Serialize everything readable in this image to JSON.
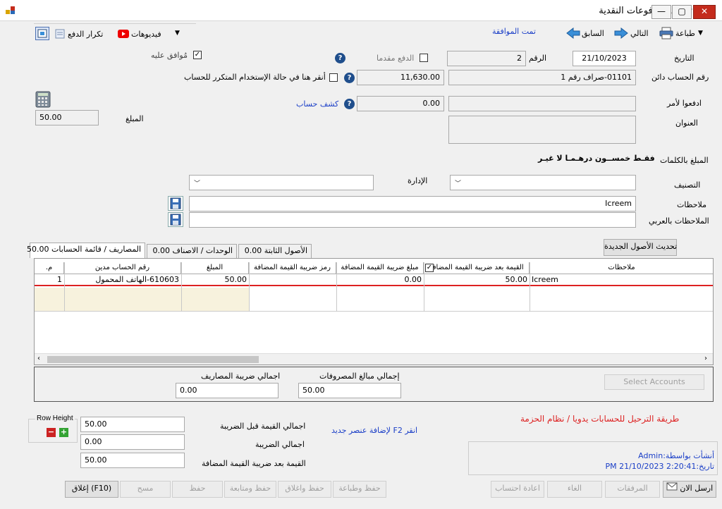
{
  "window": {
    "title": "تعديل المدفوعات النقدية",
    "minimize": "—",
    "maximize": "▢",
    "close": "✕"
  },
  "toolbar": {
    "print": "طباعة",
    "next": "التالي",
    "previous": "السابق",
    "approved": "تمت الموافقة",
    "videos": "فيديوهات",
    "repeat_payment": "تكرار الدفع"
  },
  "form": {
    "date_label": "التاريخ",
    "date_value": "21/10/2023",
    "number_label": "الرقم",
    "number_value": "2",
    "advance_label": "الدفع مقدما",
    "approved_on_label": "مُوافق عليه",
    "credit_account_label": "رقم  الحساب دائن",
    "credit_account_value": "01101-صراف رقم 1",
    "balance_value": "11,630.00",
    "recurring_label": "أنقر هنا في حالة الإستخدام المتكرر للحساب",
    "pay_to_label": "ادفعوا لأمر",
    "pay_to_value": "",
    "statement_value": "0.00",
    "statement_link": "كشف حساب",
    "address_label": "العنوان",
    "amount_label": "المبلغ",
    "amount_value": "50.00",
    "amount_words_label": "المبلغ بالكلمات",
    "amount_words_value": "فقـط خمســون درهـمـا لا غيـر",
    "classification_label": "التصنيف",
    "department_label": "الإدارة",
    "notes_label": "ملاحظات",
    "notes_value": "Icreem",
    "arabic_notes_label": "الملاحظات بالعربي",
    "arabic_notes_value": "",
    "update_assets_button": "تحديث الأصول الجديدة"
  },
  "tabs": [
    {
      "label": "المصاريف / قائمة الحسابات",
      "value": "50.00"
    },
    {
      "label": "الوحدات / الاصناف",
      "value": "0.00"
    },
    {
      "label": "الأصول الثابتة",
      "value": "0.00"
    }
  ],
  "grid": {
    "columns": {
      "row_no": "م.",
      "debit_account": "رقم الحساب مدين",
      "amount": "المبلغ",
      "vat_code": "رمز ضريبة القيمة المضافة",
      "vat_amount": "مبلغ ضريبة القيمة المضافة",
      "after_vat": "القيمة بعد ضريبة القيمة المضافة",
      "notes": "ملاحظات"
    },
    "rows": [
      {
        "row_no": "1",
        "debit_account": "610603-الهاتف المحمول",
        "amount": "50.00",
        "vat_code": "",
        "vat_amount": "0.00",
        "after_vat": "50.00",
        "notes": "Icreem"
      }
    ]
  },
  "totals_panel": {
    "expenses_total_label": "إجمالي مبالغ المصروفات",
    "expenses_total_value": "50.00",
    "expenses_tax_label": "اجمالي ضريبة المصاريف",
    "expenses_tax_value": "0.00",
    "select_accounts_button": "Select Accounts"
  },
  "row_height": {
    "label": "Row Height",
    "minus": "−",
    "plus": "+"
  },
  "summary": {
    "before_tax_label": "اجمالي القيمة قبل الضريبة",
    "before_tax_value": "50.00",
    "tax_label": "اجمالي الضريبة",
    "tax_value": "0.00",
    "after_tax_label": "القيمة بعد ضريبة القيمة المضافة",
    "after_tax_value": "50.00",
    "add_hint": "انقر F2 لإضافة عنصر جديد",
    "posting_method": "طريقة الترحيل للحسابات يدويا / نظام الحزمة"
  },
  "audit": {
    "created_by": "أنشأت بواسطة:Admin",
    "created_on": "تاريخ:2:20:41 21/10/2023 PM"
  },
  "footer_buttons": {
    "send_now": "ارسل الان",
    "attachments": "المرفقات",
    "cancel": "الغاء",
    "recalculate": "اعادة احتساب",
    "save_print": "حفظ وطباعة",
    "save_close": "حفظ واغلاق",
    "save_continue": "حفظ ومتابعة",
    "save": "حفظ",
    "clear": "مسح",
    "close": "إغلاق (F10)"
  },
  "colors": {
    "link_blue": "#1a3ec7",
    "error_red": "#d22222",
    "close_red": "#c42b1c",
    "help_blue": "#1f4e8c"
  }
}
